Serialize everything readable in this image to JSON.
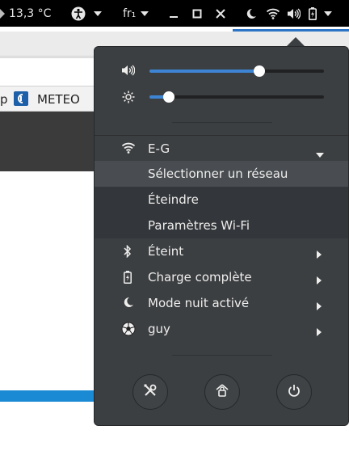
{
  "topbar": {
    "weather": "13,3 °C",
    "language": "fr₁"
  },
  "background": {
    "bookmark_prefix": "p",
    "bookmark_meteo": "METEO"
  },
  "menu": {
    "volume_level": 0.63,
    "brightness_level": 0.11,
    "wifi_name": "E-G",
    "wifi_select": "Sélectionner un réseau",
    "wifi_off": "Éteindre",
    "wifi_settings": "Paramètres Wi-Fi",
    "bluetooth": "Éteint",
    "battery": "Charge complète",
    "night_mode": "Mode nuit activé",
    "user": "guy"
  },
  "icons": {
    "accessibility": "accessibility-icon",
    "wifi": "wifi-icon",
    "volume": "volume-icon",
    "battery": "battery-icon",
    "night": "moon-icon",
    "brightness": "brightness-icon",
    "bluetooth": "bluetooth-icon",
    "user": "user-avatar-icon",
    "settings": "settings-icon",
    "lock": "lock-icon",
    "power": "power-icon"
  },
  "colors": {
    "accent": "#3d85d4",
    "menu_bg": "#3c3f42",
    "topbar_bg": "#000000"
  }
}
